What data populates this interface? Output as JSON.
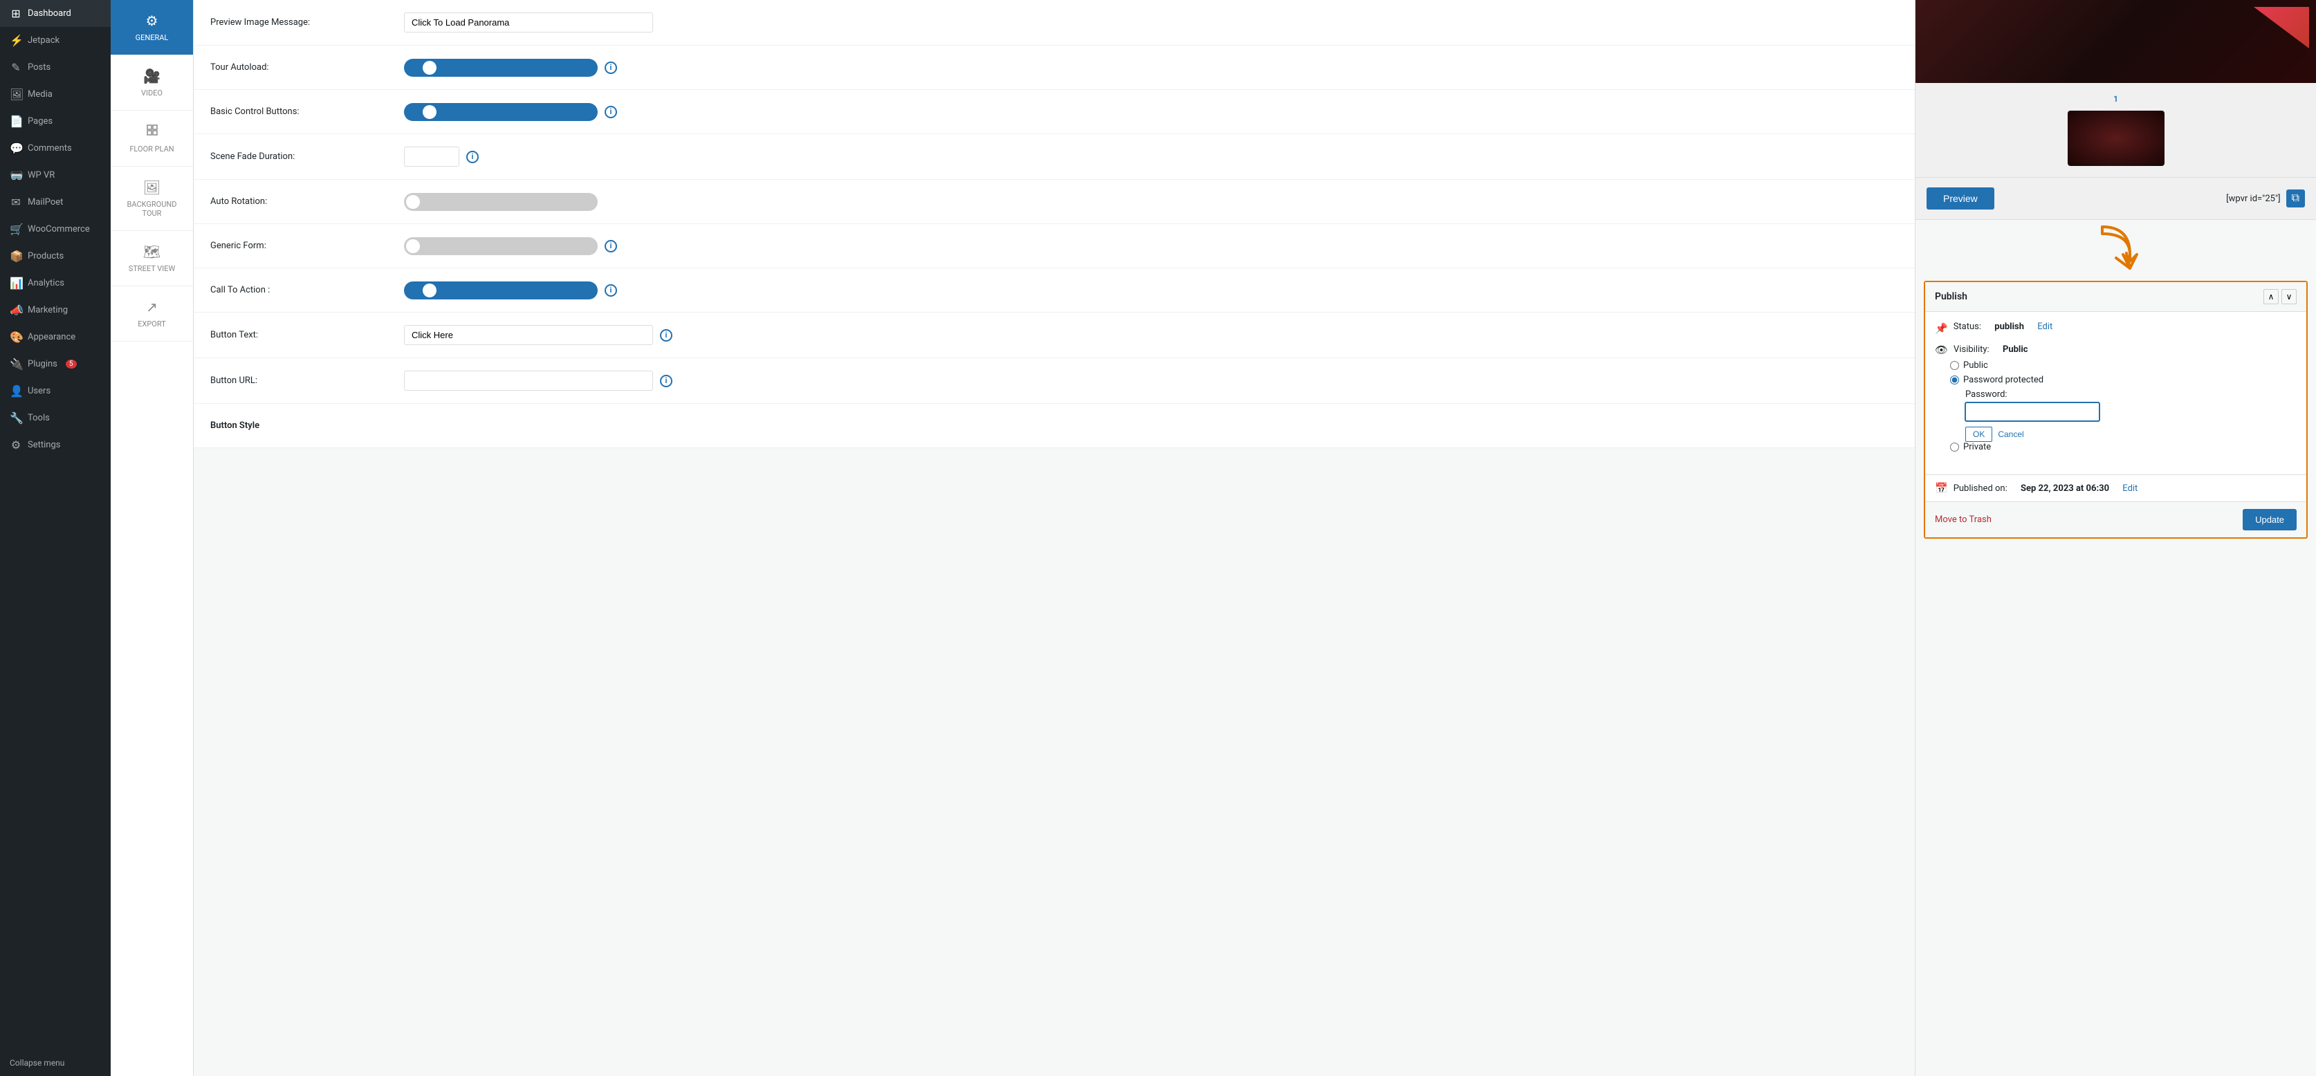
{
  "sidebar": {
    "items": [
      {
        "id": "dashboard",
        "label": "Dashboard",
        "icon": "⊞"
      },
      {
        "id": "jetpack",
        "label": "Jetpack",
        "icon": "⚡"
      },
      {
        "id": "posts",
        "label": "Posts",
        "icon": "✎"
      },
      {
        "id": "media",
        "label": "Media",
        "icon": "🖼"
      },
      {
        "id": "pages",
        "label": "Pages",
        "icon": "📄"
      },
      {
        "id": "comments",
        "label": "Comments",
        "icon": "💬"
      },
      {
        "id": "wp-vr",
        "label": "WP VR",
        "icon": "🥽"
      },
      {
        "id": "mailpoet",
        "label": "MailPoet",
        "icon": "✉"
      },
      {
        "id": "woocommerce",
        "label": "WooCommerce",
        "icon": "🛒"
      },
      {
        "id": "products",
        "label": "Products",
        "icon": "📦"
      },
      {
        "id": "analytics",
        "label": "Analytics",
        "icon": "📊"
      },
      {
        "id": "marketing",
        "label": "Marketing",
        "icon": "📣"
      },
      {
        "id": "appearance",
        "label": "Appearance",
        "icon": "🎨"
      },
      {
        "id": "plugins",
        "label": "Plugins",
        "icon": "🔌",
        "badge": "5"
      },
      {
        "id": "users",
        "label": "Users",
        "icon": "👤"
      },
      {
        "id": "tools",
        "label": "Tools",
        "icon": "🔧"
      },
      {
        "id": "settings",
        "label": "Settings",
        "icon": "⚙"
      }
    ],
    "collapse_label": "Collapse menu"
  },
  "sub_sidebar": {
    "items": [
      {
        "id": "general",
        "label": "GENERAL",
        "icon": "⚙",
        "active": true
      },
      {
        "id": "video",
        "label": "VIDEO",
        "icon": "🎥"
      },
      {
        "id": "floor-plan",
        "label": "FLOOR PLAN",
        "icon": "⊞"
      },
      {
        "id": "background-tour",
        "label": "BACKGROUND TOUR",
        "icon": "🖼"
      },
      {
        "id": "street-view",
        "label": "STREET VIEW",
        "icon": "🗺"
      },
      {
        "id": "export",
        "label": "EXPORT",
        "icon": "↗"
      }
    ]
  },
  "form": {
    "fields": [
      {
        "id": "preview-image-message",
        "label": "Preview Image Message:",
        "type": "text",
        "value": "Click To Load Panorama",
        "placeholder": ""
      },
      {
        "id": "tour-autoload",
        "label": "Tour Autoload:",
        "type": "toggle",
        "checked": true,
        "info": true
      },
      {
        "id": "basic-control-buttons",
        "label": "Basic Control Buttons:",
        "type": "toggle",
        "checked": true,
        "info": true
      },
      {
        "id": "scene-fade-duration",
        "label": "Scene Fade Duration:",
        "type": "text-small",
        "value": "",
        "info": true
      },
      {
        "id": "auto-rotation",
        "label": "Auto Rotation:",
        "type": "toggle",
        "checked": false
      },
      {
        "id": "generic-form",
        "label": "Generic Form:",
        "type": "toggle",
        "checked": false,
        "info": true
      },
      {
        "id": "call-to-action",
        "label": "Call To Action :",
        "type": "toggle",
        "checked": true,
        "info": true
      },
      {
        "id": "button-text",
        "label": "Button Text:",
        "type": "text",
        "value": "Click Here",
        "info": true
      },
      {
        "id": "button-url",
        "label": "Button URL:",
        "type": "text",
        "value": "",
        "info": true
      },
      {
        "id": "button-style",
        "label": "Button Style",
        "type": "header"
      }
    ]
  },
  "right_panel": {
    "scene_number": "1",
    "preview_button": "Preview",
    "shortcode": "[wpvr id=\"25\"]",
    "publish_title": "Publish",
    "status_label": "Status:",
    "status_value": "publish",
    "status_edit": "Edit",
    "visibility_label": "Visibility:",
    "visibility_value": "Public",
    "radio_public": "Public",
    "radio_password": "Password protected",
    "radio_private": "Private",
    "password_label": "Password:",
    "ok_label": "OK",
    "cancel_label": "Cancel",
    "published_label": "Published on:",
    "published_date": "Sep 22, 2023 at 06:30",
    "published_edit": "Edit",
    "move_trash": "Move to Trash",
    "update_button": "Update"
  },
  "colors": {
    "accent": "#2271b1",
    "publish_border": "#e07800",
    "trash": "#b32d2e"
  }
}
